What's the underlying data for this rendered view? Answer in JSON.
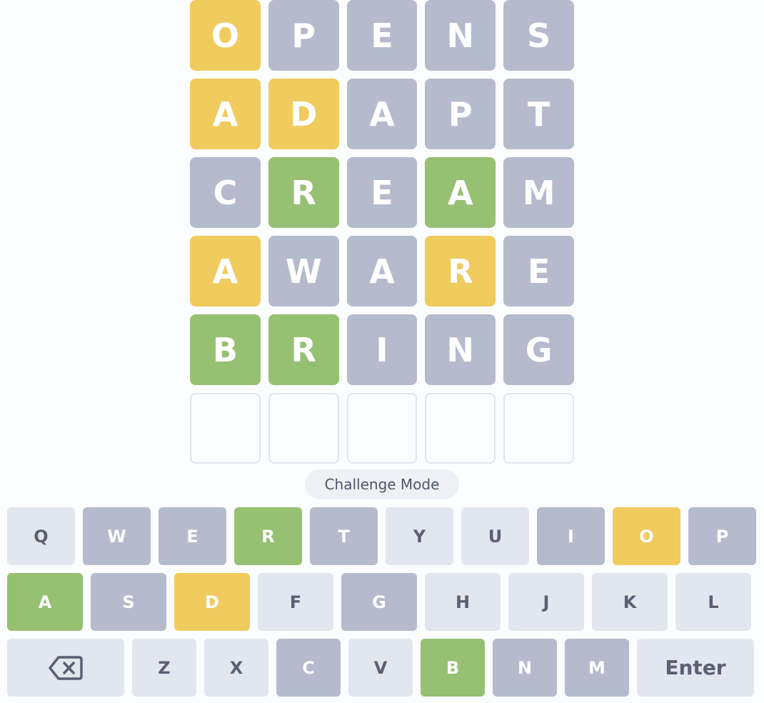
{
  "board": {
    "rows": [
      [
        {
          "letter": "O",
          "state": "present"
        },
        {
          "letter": "P",
          "state": "absent"
        },
        {
          "letter": "E",
          "state": "absent"
        },
        {
          "letter": "N",
          "state": "absent"
        },
        {
          "letter": "S",
          "state": "absent"
        }
      ],
      [
        {
          "letter": "A",
          "state": "present"
        },
        {
          "letter": "D",
          "state": "present"
        },
        {
          "letter": "A",
          "state": "absent"
        },
        {
          "letter": "P",
          "state": "absent"
        },
        {
          "letter": "T",
          "state": "absent"
        }
      ],
      [
        {
          "letter": "C",
          "state": "absent"
        },
        {
          "letter": "R",
          "state": "correct"
        },
        {
          "letter": "E",
          "state": "absent"
        },
        {
          "letter": "A",
          "state": "correct"
        },
        {
          "letter": "M",
          "state": "absent"
        }
      ],
      [
        {
          "letter": "A",
          "state": "present"
        },
        {
          "letter": "W",
          "state": "absent"
        },
        {
          "letter": "A",
          "state": "absent"
        },
        {
          "letter": "R",
          "state": "present"
        },
        {
          "letter": "E",
          "state": "absent"
        }
      ],
      [
        {
          "letter": "B",
          "state": "correct"
        },
        {
          "letter": "R",
          "state": "correct"
        },
        {
          "letter": "I",
          "state": "absent"
        },
        {
          "letter": "N",
          "state": "absent"
        },
        {
          "letter": "G",
          "state": "absent"
        }
      ],
      [
        {
          "letter": "",
          "state": "empty"
        },
        {
          "letter": "",
          "state": "empty"
        },
        {
          "letter": "",
          "state": "empty"
        },
        {
          "letter": "",
          "state": "empty"
        },
        {
          "letter": "",
          "state": "empty"
        }
      ]
    ]
  },
  "mode_label": "Challenge Mode",
  "keyboard": {
    "rows": [
      [
        {
          "label": "Q",
          "state": "unused",
          "w": 95
        },
        {
          "label": "W",
          "state": "absent",
          "w": 95
        },
        {
          "label": "E",
          "state": "absent",
          "w": 95
        },
        {
          "label": "R",
          "state": "correct",
          "w": 95
        },
        {
          "label": "T",
          "state": "absent",
          "w": 95
        },
        {
          "label": "Y",
          "state": "unused",
          "w": 95
        },
        {
          "label": "U",
          "state": "unused",
          "w": 95
        },
        {
          "label": "I",
          "state": "absent",
          "w": 95
        },
        {
          "label": "O",
          "state": "present",
          "w": 95
        },
        {
          "label": "P",
          "state": "absent",
          "w": 95
        }
      ],
      [
        {
          "label": "A",
          "state": "correct",
          "w": 106
        },
        {
          "label": "S",
          "state": "absent",
          "w": 106
        },
        {
          "label": "D",
          "state": "present",
          "w": 106
        },
        {
          "label": "F",
          "state": "unused",
          "w": 106
        },
        {
          "label": "G",
          "state": "absent",
          "w": 106
        },
        {
          "label": "H",
          "state": "unused",
          "w": 106
        },
        {
          "label": "J",
          "state": "unused",
          "w": 106
        },
        {
          "label": "K",
          "state": "unused",
          "w": 106
        },
        {
          "label": "L",
          "state": "unused",
          "w": 106
        }
      ],
      [
        {
          "label": "",
          "icon": "backspace-icon",
          "state": "unused",
          "w": 164
        },
        {
          "label": "Z",
          "state": "unused",
          "w": 90
        },
        {
          "label": "X",
          "state": "unused",
          "w": 90
        },
        {
          "label": "C",
          "state": "absent",
          "w": 90
        },
        {
          "label": "V",
          "state": "unused",
          "w": 90
        },
        {
          "label": "B",
          "state": "correct",
          "w": 90
        },
        {
          "label": "N",
          "state": "absent",
          "w": 90
        },
        {
          "label": "M",
          "state": "absent",
          "w": 90
        },
        {
          "label": "Enter",
          "state": "unused",
          "w": 164
        }
      ]
    ]
  }
}
